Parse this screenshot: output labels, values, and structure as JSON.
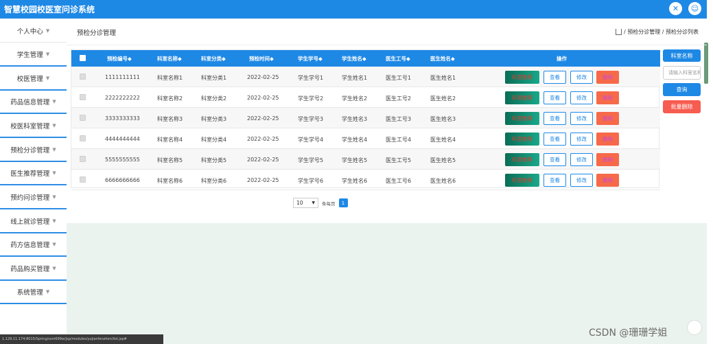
{
  "app": {
    "title": "智慧校园校医室问诊系统"
  },
  "topbar_icons": [
    "fullscreen-icon",
    "user-icon"
  ],
  "sidebar": {
    "items": [
      {
        "label": "个人中心"
      },
      {
        "label": "学生管理"
      },
      {
        "label": "校医管理"
      },
      {
        "label": "药品信息管理"
      },
      {
        "label": "校医科室管理"
      },
      {
        "label": "预检分诊管理"
      },
      {
        "label": "医生推荐管理"
      },
      {
        "label": "预约问诊管理"
      },
      {
        "label": "线上就诊管理"
      },
      {
        "label": "药方信息管理"
      },
      {
        "label": "药品购买管理"
      },
      {
        "label": "系统管理"
      }
    ]
  },
  "page": {
    "title": "预检分诊管理",
    "breadcrumb": "/ 预检分诊管理 / 预检分诊列表"
  },
  "table": {
    "headers": [
      "预检编号",
      "科室名称",
      "科室分类",
      "预检时间",
      "学生学号",
      "学生姓名",
      "医生工号",
      "医生姓名",
      "操作"
    ],
    "sort_mark": "◆",
    "rows": [
      {
        "id": "1111111111",
        "dept": "科室名称1",
        "cat": "科室分类1",
        "time": "2022-02-25",
        "sno": "学生学号1",
        "sname": "学生姓名1",
        "dno": "医生工号1",
        "dname": "医生姓名1"
      },
      {
        "id": "2222222222",
        "dept": "科室名称2",
        "cat": "科室分类2",
        "time": "2022-02-25",
        "sno": "学生学号2",
        "sname": "学生姓名2",
        "dno": "医生工号2",
        "dname": "医生姓名2"
      },
      {
        "id": "3333333333",
        "dept": "科室名称3",
        "cat": "科室分类3",
        "time": "2022-02-25",
        "sno": "学生学号3",
        "sname": "学生姓名3",
        "dno": "医生工号3",
        "dname": "医生姓名3"
      },
      {
        "id": "4444444444",
        "dept": "科室名称4",
        "cat": "科室分类4",
        "time": "2022-02-25",
        "sno": "学生学号4",
        "sname": "学生姓名4",
        "dno": "医生工号4",
        "dname": "医生姓名4"
      },
      {
        "id": "5555555555",
        "dept": "科室名称5",
        "cat": "科室分类5",
        "time": "2022-02-25",
        "sno": "学生学号5",
        "sname": "学生姓名5",
        "dno": "医生工号5",
        "dname": "医生姓名5"
      },
      {
        "id": "6666666666",
        "dept": "科室名称6",
        "cat": "科室分类6",
        "time": "2022-02-25",
        "sno": "学生学号6",
        "sname": "学生姓名6",
        "dno": "医生工号6",
        "dname": "医生姓名6"
      }
    ],
    "actions": {
      "push": "科室推荐",
      "view": "查看",
      "edit": "修改",
      "delete": "删除"
    }
  },
  "pagination": {
    "page_size": "10",
    "per_page_text": "条每页",
    "current": "1"
  },
  "search_panel": {
    "label": "科室名称",
    "placeholder": "请输入科室名称",
    "search_button": "查询",
    "batch_delete_button": "批量删除"
  },
  "statusbar": {
    "text": "1.129.11.174:8015/Spring/ssm699w/jsp/modules/yujianfenzhen/list.jsp#"
  },
  "watermark": "CSDN @珊珊学姐",
  "colors": {
    "primary": "#1e88e5",
    "danger": "#f75c50",
    "push_gradient_start": "#0b6d56",
    "background_green": "#ebf3ee"
  }
}
